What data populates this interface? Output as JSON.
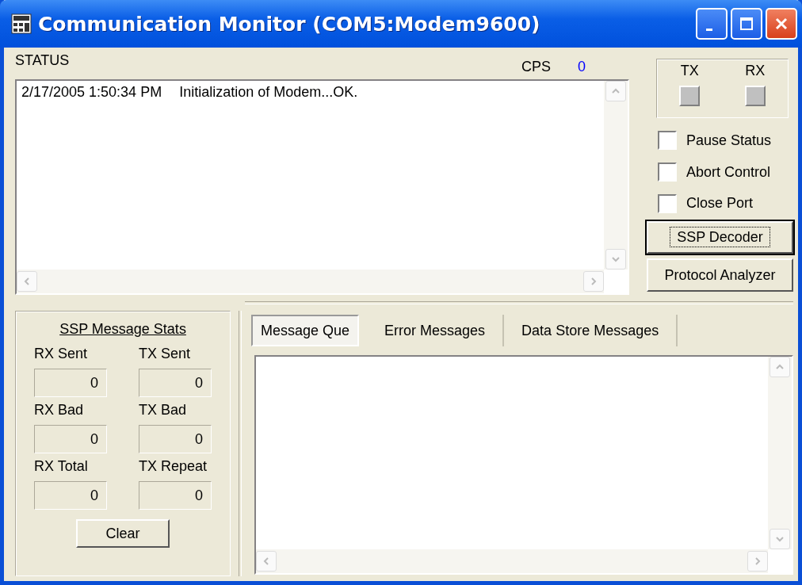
{
  "window": {
    "title": "Communication Monitor (COM5:Modem9600)"
  },
  "status": {
    "label": "STATUS",
    "cps_label": "CPS",
    "cps_value": "0",
    "lines": [
      {
        "time": "2/17/2005 1:50:34 PM",
        "message": "Initialization of Modem...OK."
      }
    ]
  },
  "indicators": [
    {
      "label": "TX",
      "on": false
    },
    {
      "label": "RX",
      "on": false
    }
  ],
  "options": [
    {
      "label": "Pause Status",
      "checked": false
    },
    {
      "label": "Abort Control",
      "checked": false
    },
    {
      "label": "Close Port",
      "checked": false
    }
  ],
  "buttons": [
    {
      "label": "SSP Decoder",
      "focused": true
    },
    {
      "label": "Protocol Analyzer",
      "focused": false
    }
  ],
  "stats": {
    "title": "SSP Message Stats",
    "fields": [
      {
        "label": "RX Sent",
        "value": "0"
      },
      {
        "label": "TX Sent",
        "value": "0"
      },
      {
        "label": "RX Bad",
        "value": "0"
      },
      {
        "label": "TX Bad",
        "value": "0"
      },
      {
        "label": "RX Total",
        "value": "0"
      },
      {
        "label": "TX Repeat",
        "value": "0"
      }
    ],
    "clear_button": "Clear"
  },
  "tabs": [
    {
      "label": "Message Que",
      "selected": true
    },
    {
      "label": "Error Messages",
      "selected": false
    },
    {
      "label": "Data Store Messages",
      "selected": false
    }
  ]
}
